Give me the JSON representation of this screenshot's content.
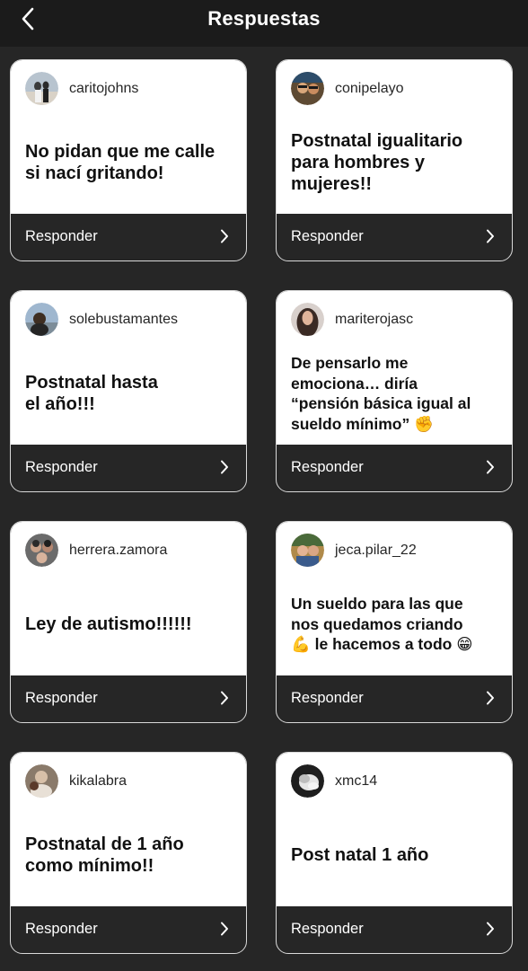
{
  "header": {
    "title": "Respuestas",
    "back_icon": "chevron-left-icon"
  },
  "cards": [
    {
      "username": "caritojohns",
      "text": "No pidan que me calle\nsi nací gritando!",
      "avatar": "user-avatar-icon",
      "reply_label": "Responder"
    },
    {
      "username": "conipelayo",
      "text": "Postnatal igualitario\npara hombres y\nmujeres!!",
      "avatar": "user-avatar-icon",
      "reply_label": "Responder"
    },
    {
      "username": "solebustamantes",
      "text": "Postnatal hasta\nel año!!!",
      "avatar": "user-avatar-icon",
      "reply_label": "Responder"
    },
    {
      "username": "mariterojasc",
      "text": "De pensarlo me\nemociona… diría\n“pensión básica igual al\nsueldo mínimo” ✊",
      "avatar": "user-avatar-icon",
      "reply_label": "Responder"
    },
    {
      "username": "herrera.zamora",
      "text": "Ley de autismo!!!!!!",
      "avatar": "user-avatar-icon",
      "reply_label": "Responder"
    },
    {
      "username": "jeca.pilar_22",
      "text": "Un sueldo para las que\nnos quedamos criando\n💪 le hacemos a todo 😁",
      "avatar": "user-avatar-icon",
      "reply_label": "Responder"
    },
    {
      "username": "kikalabra",
      "text": "Postnatal de 1 año\ncomo mínimo!!",
      "avatar": "user-avatar-icon",
      "reply_label": "Responder"
    },
    {
      "username": "xmc14",
      "text": "Post natal 1 año",
      "avatar": "user-avatar-icon",
      "reply_label": "Responder"
    }
  ],
  "colors": {
    "background": "#262626",
    "topbar": "#1b1b1b",
    "card_top": "#ffffff",
    "card_border": "#d9d9d9"
  }
}
